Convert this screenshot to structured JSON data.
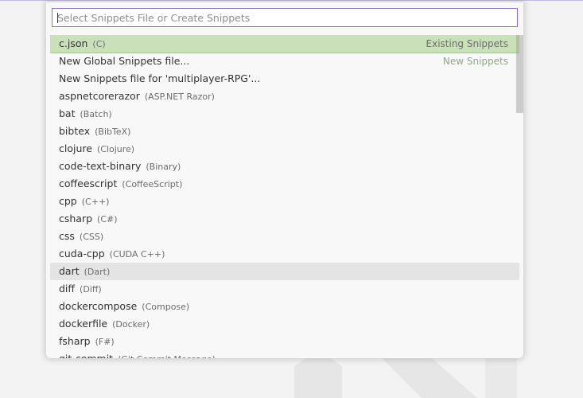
{
  "quick_pick": {
    "placeholder": "Select Snippets File or Create Snippets",
    "value": ""
  },
  "items": [
    {
      "label": "c.json",
      "desc": "(C)",
      "detail": "Existing Snippets",
      "state": "selected"
    },
    {
      "label": "New Global Snippets file...",
      "desc": "",
      "detail": "New Snippets",
      "state": "normal"
    },
    {
      "label": "New Snippets file for 'multiplayer-RPG'...",
      "desc": "",
      "detail": "",
      "state": "normal"
    },
    {
      "label": "aspnetcorerazor",
      "desc": "(ASP.NET Razor)",
      "detail": "",
      "state": "normal"
    },
    {
      "label": "bat",
      "desc": "(Batch)",
      "detail": "",
      "state": "normal"
    },
    {
      "label": "bibtex",
      "desc": "(BibTeX)",
      "detail": "",
      "state": "normal"
    },
    {
      "label": "clojure",
      "desc": "(Clojure)",
      "detail": "",
      "state": "normal"
    },
    {
      "label": "code-text-binary",
      "desc": "(Binary)",
      "detail": "",
      "state": "normal"
    },
    {
      "label": "coffeescript",
      "desc": "(CoffeeScript)",
      "detail": "",
      "state": "normal"
    },
    {
      "label": "cpp",
      "desc": "(C++)",
      "detail": "",
      "state": "normal"
    },
    {
      "label": "csharp",
      "desc": "(C#)",
      "detail": "",
      "state": "normal"
    },
    {
      "label": "css",
      "desc": "(CSS)",
      "detail": "",
      "state": "normal"
    },
    {
      "label": "cuda-cpp",
      "desc": "(CUDA C++)",
      "detail": "",
      "state": "normal"
    },
    {
      "label": "dart",
      "desc": "(Dart)",
      "detail": "",
      "state": "hover"
    },
    {
      "label": "diff",
      "desc": "(Diff)",
      "detail": "",
      "state": "normal"
    },
    {
      "label": "dockercompose",
      "desc": "(Compose)",
      "detail": "",
      "state": "normal"
    },
    {
      "label": "dockerfile",
      "desc": "(Docker)",
      "detail": "",
      "state": "normal"
    },
    {
      "label": "fsharp",
      "desc": "(F#)",
      "detail": "",
      "state": "normal"
    },
    {
      "label": "git-commit",
      "desc": "(Git Commit Message)",
      "detail": "",
      "state": "normal"
    }
  ],
  "colors": {
    "accent": "#8f6cd5",
    "selected_bg": "#c9e0b9",
    "hover_bg": "#e4e4e4"
  },
  "icons": {
    "watermark": "vscode-logo-icon"
  }
}
